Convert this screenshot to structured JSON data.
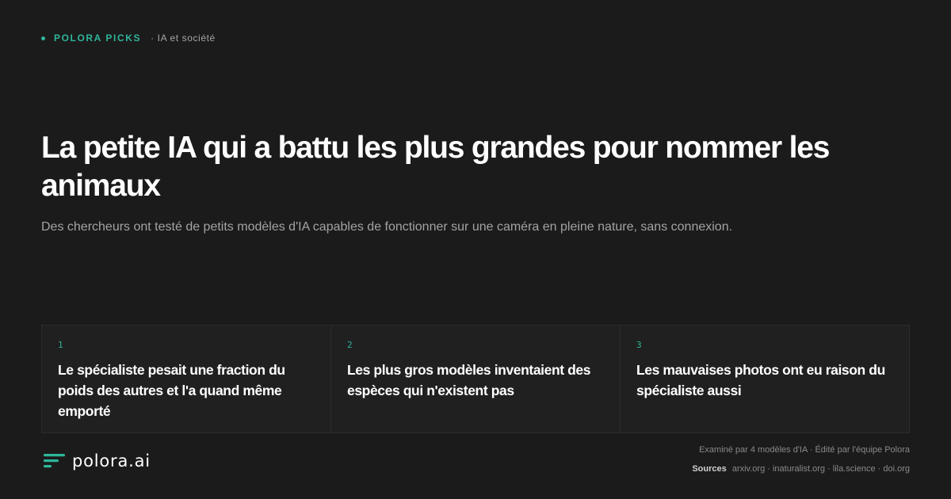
{
  "eyebrow": {
    "brand": "POLORA PICKS",
    "category": "· IA et société"
  },
  "headline": "La petite IA qui a battu les plus grandes pour nommer les animaux",
  "subtitle": "Des chercheurs ont testé de petits modèles d'IA capables de fonctionner sur une caméra en pleine nature, sans connexion.",
  "cards": [
    {
      "number": "1",
      "text": "Le spécialiste pesait une fraction du poids des autres et l'a quand même emporté"
    },
    {
      "number": "2",
      "text": "Les plus gros modèles inventaient des espèces qui n'existent pas"
    },
    {
      "number": "3",
      "text": "Les mauvaises photos ont eu raison du spécialiste aussi"
    }
  ],
  "logo": {
    "text": "polora.ai",
    "icon": "polora-logo-icon"
  },
  "meta": {
    "review_line": "Examiné par 4 modèles d'IA · Édité par l'équipe Polora",
    "sources_label": "Sources",
    "sources": "arxiv.org · inaturalist.org · lila.science · doi.org"
  },
  "colors": {
    "background": "#1b1b1b",
    "accent": "#2fb59a",
    "card_background": "#202020",
    "muted_text": "#a3a3a3"
  }
}
